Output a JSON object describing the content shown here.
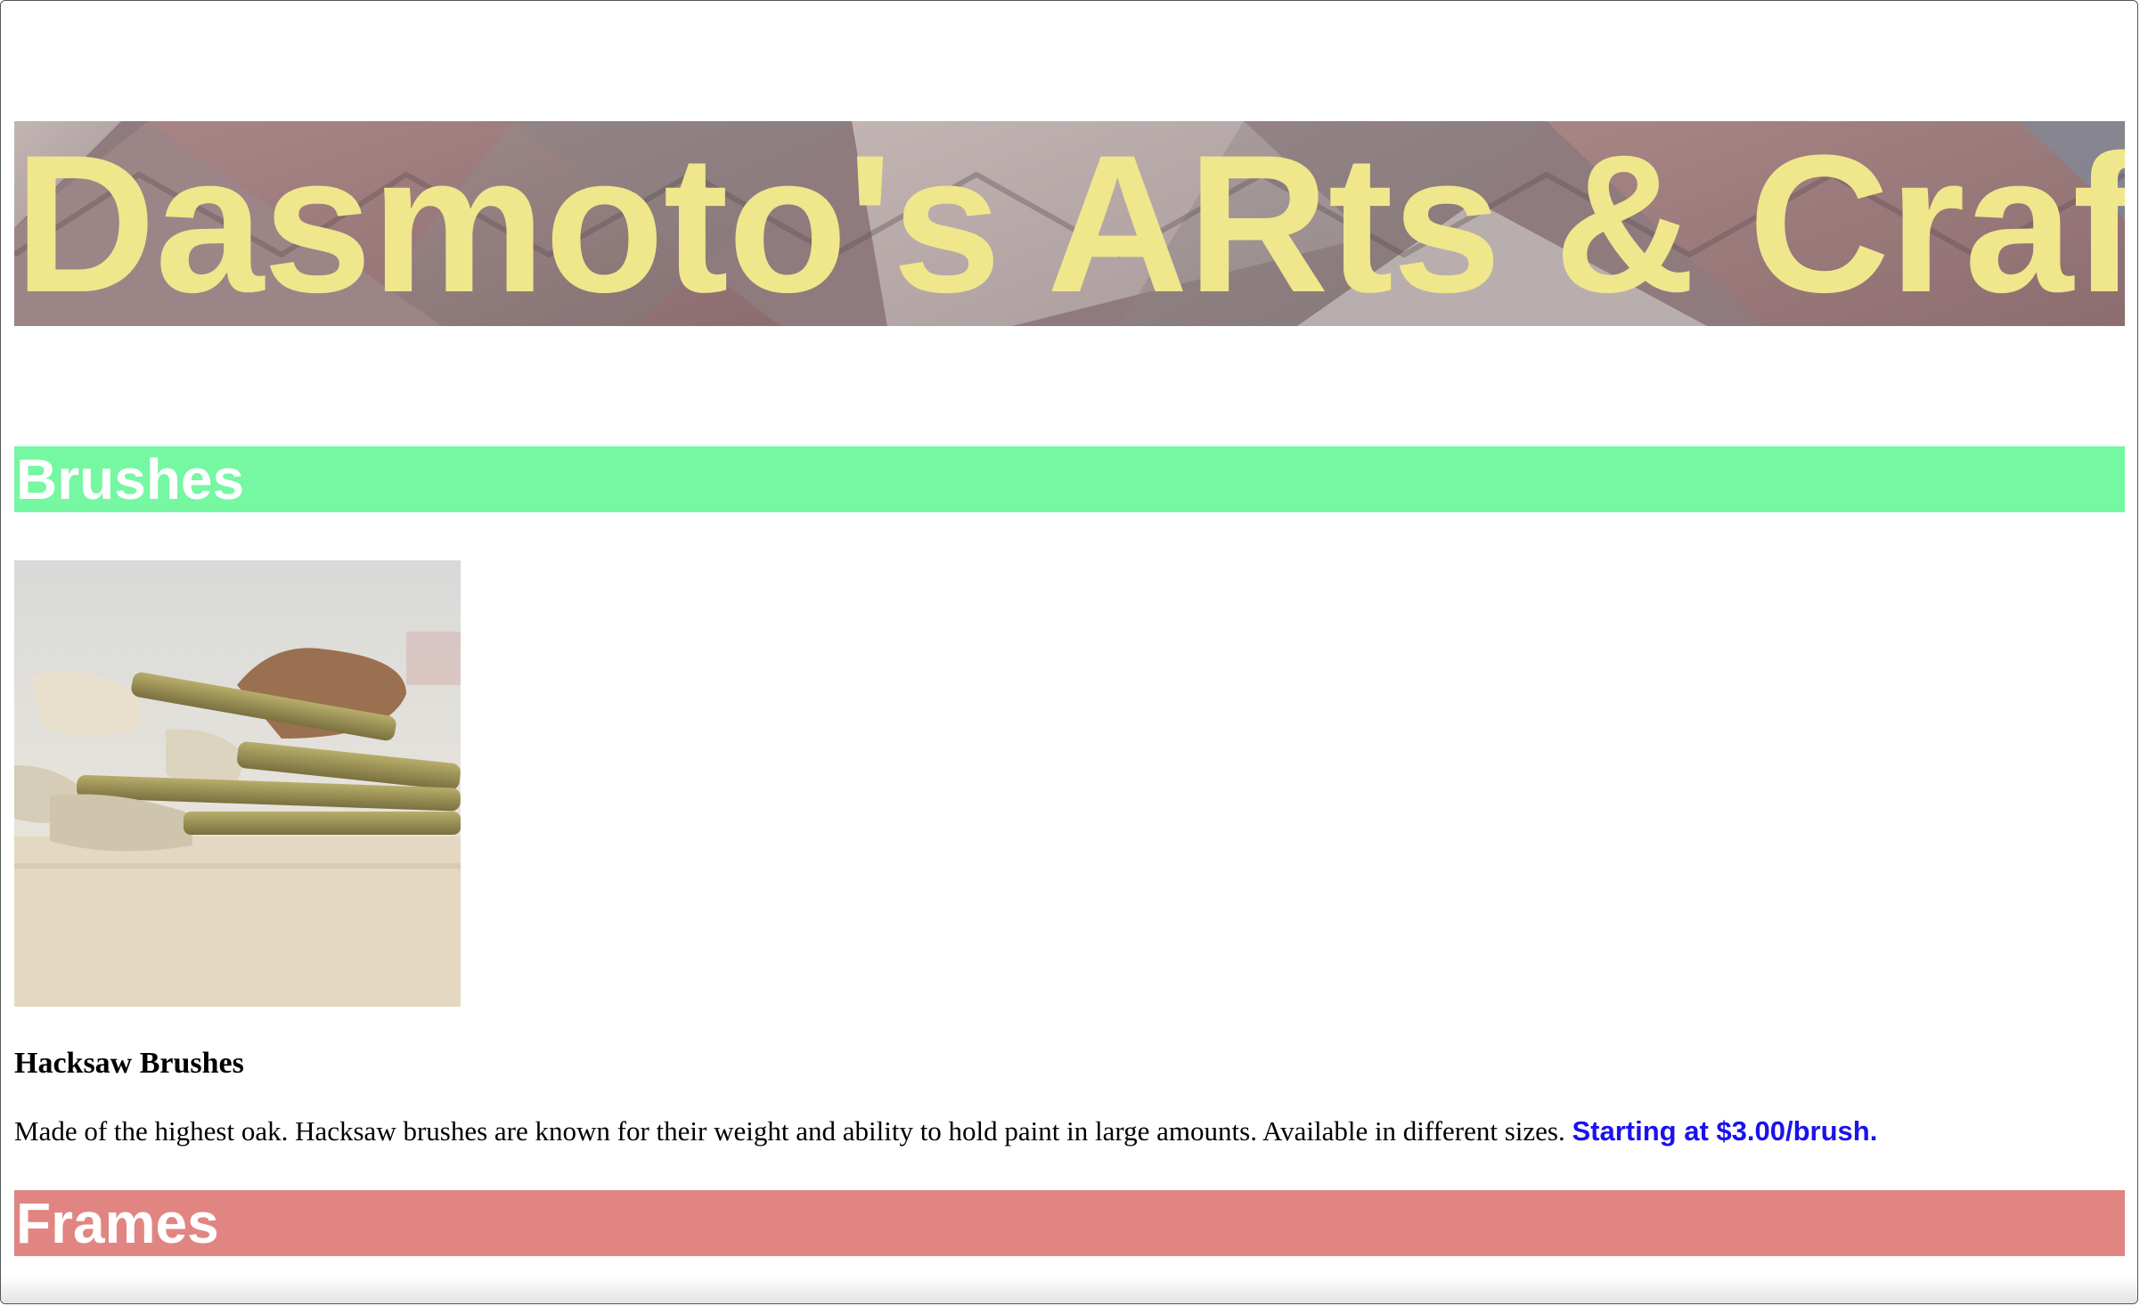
{
  "header": {
    "title": "Dasmoto's ARts & Crafts"
  },
  "sections": [
    {
      "heading": "Brushes",
      "color": "#76f7a2",
      "product": {
        "name": "Hacksaw Brushes",
        "description": "Made of the highest oak. Hacksaw brushes are known for their weight and ability to hold paint in large amounts. Available in different sizes.",
        "price": "Starting at $3.00/brush."
      }
    },
    {
      "heading": "Frames",
      "color": "#e18582"
    }
  ],
  "colors": {
    "title_text": "#f0e68c",
    "price_text": "#1a12ee"
  }
}
